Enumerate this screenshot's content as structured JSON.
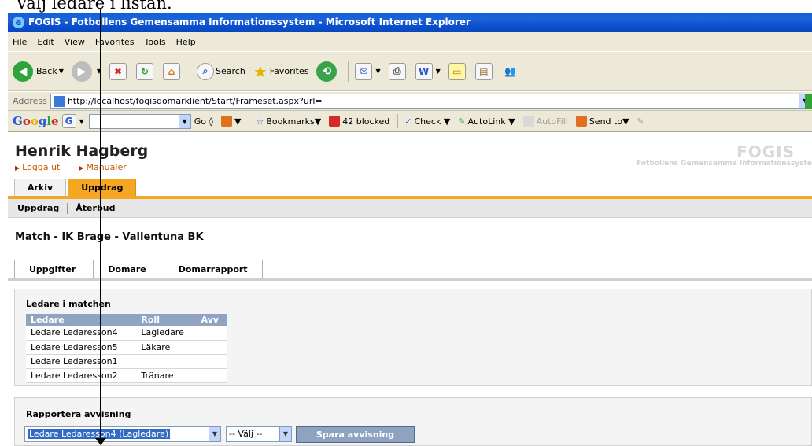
{
  "caption": "Välj ledare i listan.",
  "window": {
    "title": "FOGIS - Fotbollens Gemensamma Informationssystem - Microsoft Internet Explorer"
  },
  "menu": [
    "File",
    "Edit",
    "View",
    "Favorites",
    "Tools",
    "Help"
  ],
  "toolbar": {
    "back": "Back",
    "search": "Search",
    "favorites": "Favorites"
  },
  "address": {
    "label": "Address",
    "url": "http://localhost/fogisdomarklient/Start/Frameset.aspx?url="
  },
  "googlebar": {
    "logo": "Google",
    "go": "Go",
    "bookmarks": "Bookmarks",
    "blocked": "42 blocked",
    "check": "Check",
    "autolink": "AutoLink",
    "autofill": "AutoFill",
    "sendto": "Send to"
  },
  "header": {
    "user_name": "Henrik Hagberg",
    "links": [
      "Logga ut",
      "Manualer"
    ],
    "logo": "FOGIS",
    "logo_sub": "Fotbollens Gemensamma Informationssyste"
  },
  "main_tabs": [
    "Arkiv",
    "Uppdrag"
  ],
  "subnav": [
    "Uppdrag",
    "Återbud"
  ],
  "match_title": "Match - IK Brage - Vallentuna BK",
  "detail_tabs": [
    "Uppgifter",
    "Domare",
    "Domarrapport"
  ],
  "leaders": {
    "title": "Ledare i matchen",
    "columns": [
      "Ledare",
      "Roll",
      "Avv"
    ],
    "rows": [
      [
        "Ledare Ledaresson4",
        "Lagledare",
        ""
      ],
      [
        "Ledare Ledaresson5",
        "Läkare",
        ""
      ],
      [
        "Ledare Ledaresson1",
        "",
        ""
      ],
      [
        "Ledare Ledaresson2",
        "Tränare",
        ""
      ]
    ]
  },
  "report": {
    "title": "Rapportera avvisning",
    "leader_select": "Ledare Ledaresson4 (Lagledare)",
    "reason_select": "-- Välj --",
    "save_label": "Spara avvisning"
  }
}
